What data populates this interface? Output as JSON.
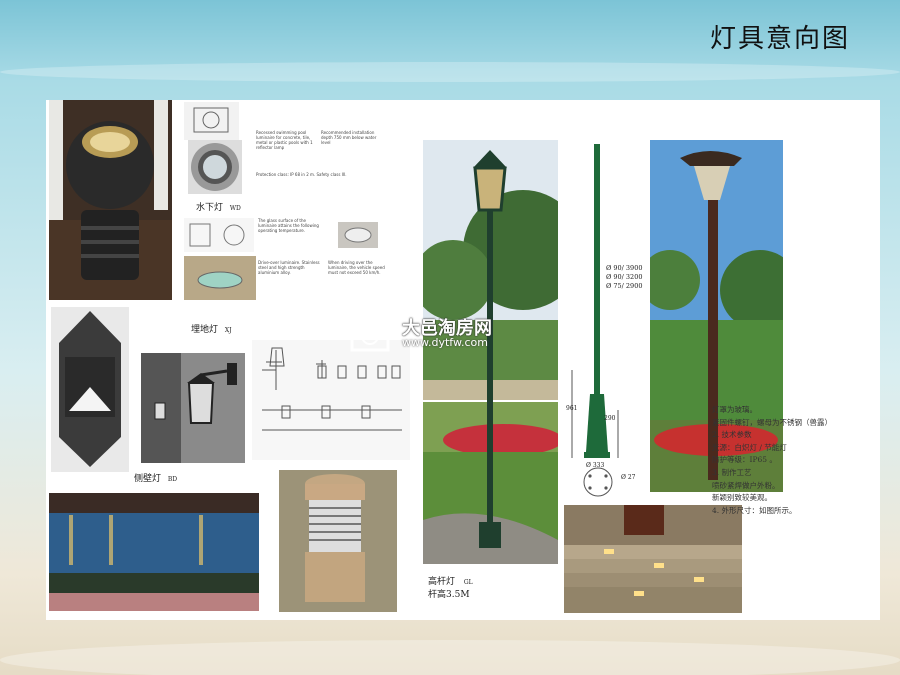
{
  "slide": {
    "title": "灯具意向图"
  },
  "captions": {
    "underwater": "水下灯",
    "underwater_code": "WD",
    "buried": "埋地灯",
    "buried_code": "XJ",
    "wall": "侧壁灯",
    "wall_code": "BD",
    "pole_line1": "高杆灯",
    "pole_line2": "杆高3.5M",
    "pole_code": "GL"
  },
  "pole_dims": {
    "d1": "Ø 90/ 3900",
    "d2": "Ø 90/ 3200",
    "d3": "Ø 75/ 2900",
    "h1": "961",
    "h2": "290",
    "base": "Ø 333",
    "bolt": "Ø 27"
  },
  "notes": [
    "灯罩为玻璃。",
    "紧固件螺钉，螺母为不锈钢（兽露）",
    "2. 技术参数",
    "光源：白炽灯 / 节能灯",
    "防护等级：IP65 。",
    "3. 制作工艺",
    "喷砂紧焊做户外粉。",
    "新颖别致较美观。",
    "4. 外形尺寸：如图所示。"
  ],
  "watermark": {
    "name": "大邑淘房网",
    "url": "www.dytfw.com"
  },
  "spec_texts": {
    "a": "Recessed swimming pool luminaire for concrete, tile, metal or plastic pools with 1 reflector lamp",
    "b": "Recommended installation depth 750 mm below water level",
    "c": "Protection class: IP 68 in 2 m. Safety class III.",
    "d": "The glass surface of the luminaire attains the following operating temperature.",
    "e": "Drive-over luminaire. Stainless steel and high strength aluminium alloy.",
    "f": "When driving over the luminaire, the vehicle speed must not exceed 50 km/h."
  }
}
